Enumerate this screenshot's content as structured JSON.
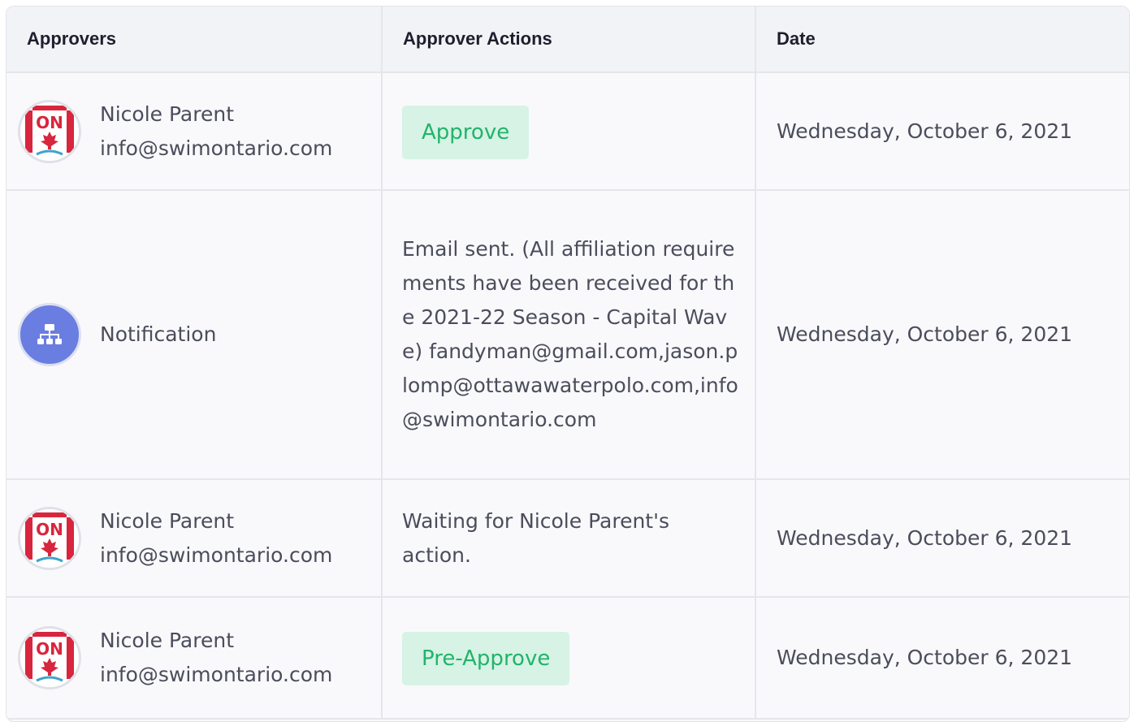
{
  "columns": {
    "approvers": "Approvers",
    "actions": "Approver Actions",
    "date": "Date"
  },
  "rows": [
    {
      "avatar_icon": "swim-ontario-logo-icon",
      "name": "Nicole Parent",
      "email": "info@swimontario.com",
      "action_button": "Approve",
      "date": "Wednesday, October 6, 2021"
    },
    {
      "avatar_icon": "sitemap-icon",
      "name": "Notification",
      "action_text": "Email sent. (All affiliation requirements have been received for the 2021-22 Season - Capital Wave) fandyman@gmail.com,jason.plomp@ottawawaterpolo.com,info@swimontario.com",
      "date": "Wednesday, October 6, 2021"
    },
    {
      "avatar_icon": "swim-ontario-logo-icon",
      "name": "Nicole Parent",
      "email": "info@swimontario.com",
      "action_text": "Waiting for Nicole Parent's action.",
      "date": "Wednesday, October 6, 2021"
    },
    {
      "avatar_icon": "swim-ontario-logo-icon",
      "name": "Nicole Parent",
      "email": "info@swimontario.com",
      "action_button": "Pre-Approve",
      "date": "Wednesday, October 6, 2021"
    }
  ],
  "logo_text": "ON",
  "colors": {
    "approve_bg": "#d6f3e5",
    "approve_text": "#22b46a",
    "notification_avatar": "#6a7de0",
    "logo_red": "#d7263d"
  }
}
